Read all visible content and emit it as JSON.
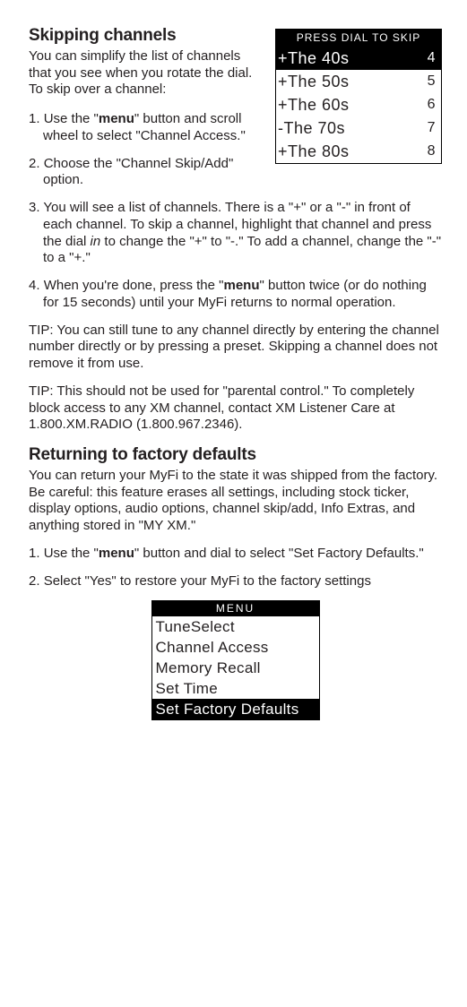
{
  "skipping": {
    "heading": "Skipping channels",
    "intro": "You can simplify the list of channels that you see when you rotate the dial. To skip over a channel:",
    "step1_pre": "Use the \"",
    "step1_bold": "menu",
    "step1_post": "\" button and scroll wheel to select \"Channel Access.\"",
    "step2": "Choose the \"Channel Skip/Add\" option.",
    "step3_a": "You will see a list of channels. There is a \"+\" or a \"-\" in front of each channel. To skip a channel, highlight that channel and press the dial ",
    "step3_ital": "in",
    "step3_b": " to change the \"+\" to \"-.\" To add a channel, change the \"-\" to a \"+.\"",
    "step4_a": "When you're done, press the \"",
    "step4_bold": "menu",
    "step4_b": "\" button twice (or do nothing for 15 seconds) until your MyFi returns to normal operation.",
    "tip1": "TIP: You can still tune to any channel directly by entering the channel number directly or by pressing a preset.  Skipping a channel does not remove it from use.",
    "tip2": "TIP: This should not be used for \"parental control.\" To completely block access to any XM channel, contact XM Listener Care at 1.800.XM.RADIO (1.800.967.2346)."
  },
  "skip_lcd": {
    "header": "PRESS DIAL TO SKIP",
    "rows": [
      {
        "name": "+The 40s",
        "num": "4",
        "sel": true
      },
      {
        "name": "+The 50s",
        "num": "5",
        "sel": false
      },
      {
        "name": "+The 60s",
        "num": "6",
        "sel": false
      },
      {
        "name": "-The 70s",
        "num": "7",
        "sel": false
      },
      {
        "name": "+The 80s",
        "num": "8",
        "sel": false
      }
    ]
  },
  "factory": {
    "heading": "Returning to factory defaults",
    "intro": "You can return your MyFi to the state it was shipped from the factory. Be careful: this feature erases all settings, including stock ticker, display options, audio options, channel skip/add, Info Extras, and anything stored in \"MY XM.\"",
    "step1_a": "Use the \"",
    "step1_bold": "menu",
    "step1_b": "\" button and dial to select \"Set Factory Defaults.\"",
    "step2": "Select \"Yes\" to restore your MyFi to the factory settings"
  },
  "menu_lcd": {
    "header": "MENU",
    "rows": [
      {
        "label": "TuneSelect",
        "sel": false
      },
      {
        "label": "Channel Access",
        "sel": false
      },
      {
        "label": "Memory Recall",
        "sel": false
      },
      {
        "label": "Set Time",
        "sel": false
      },
      {
        "label": "Set Factory Defaults",
        "sel": true
      }
    ]
  }
}
